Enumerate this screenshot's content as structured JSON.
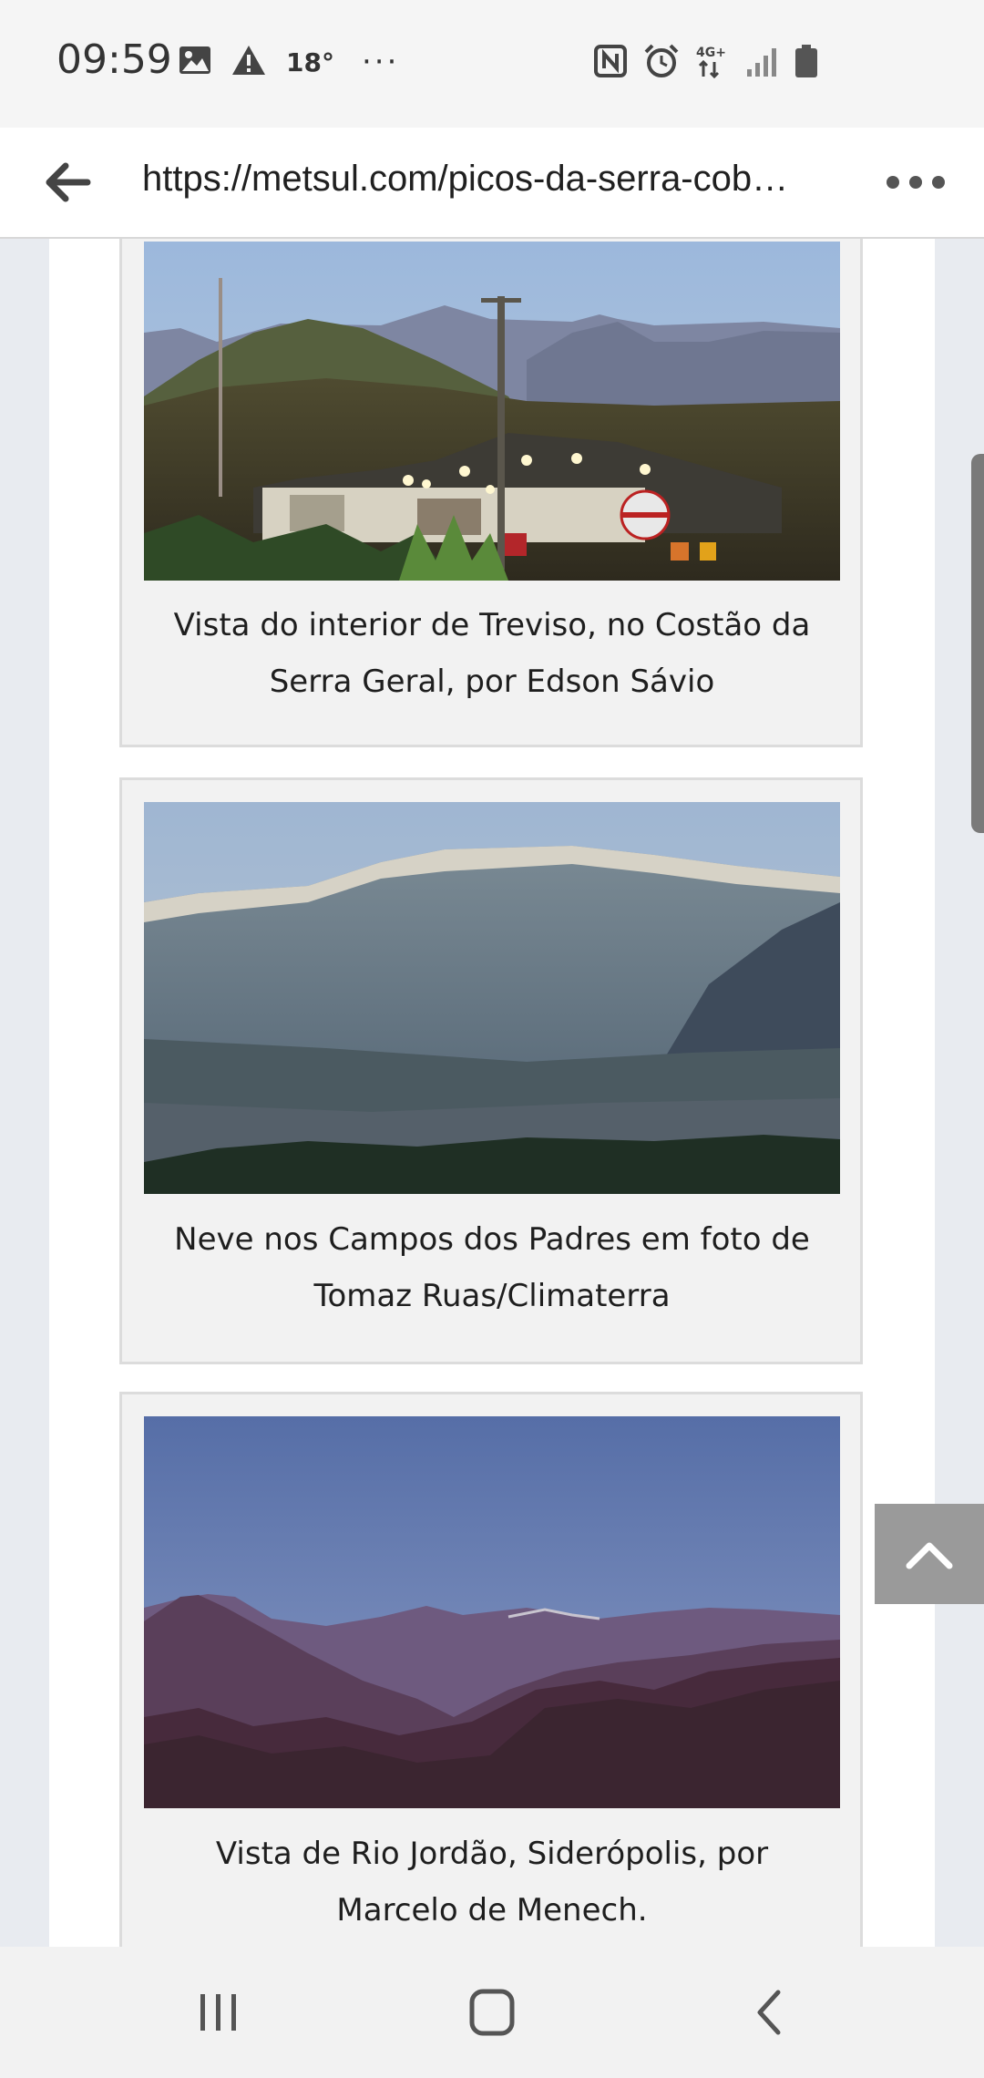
{
  "status_bar": {
    "time": "09:59",
    "temperature": "18°",
    "overflow": "···",
    "network": "4G+",
    "icons_left": [
      "image-icon",
      "warning-icon"
    ],
    "icons_right": [
      "nfc-icon",
      "alarm-icon",
      "network-4g-icon",
      "signal-icon",
      "battery-icon"
    ]
  },
  "browser": {
    "url": "https://metsul.com/picos-da-serra-cob…"
  },
  "figures": [
    {
      "caption": "Vista do interior de Treviso, no Costão da Serra Geral, por Edson Sávio",
      "line1": "Vista do interior de Treviso, no Costão da",
      "line2": "Serra Geral, por Edson Sávio"
    },
    {
      "caption": "Neve nos Campos dos Padres em foto de Tomaz Ruas/Climaterra",
      "line1": "Neve nos Campos dos Padres em foto de",
      "line2": "Tomaz Ruas/Climaterra"
    },
    {
      "caption": "Vista de Rio Jordão, Siderópolis, por Marcelo de Menech.",
      "line1": "Vista de Rio Jordão, Siderópolis, por",
      "line2": "Marcelo de Menech."
    }
  ],
  "colors": {
    "page_bg": "#e8ebf0",
    "card_bg": "#f2f2f2",
    "card_border": "#dcdcdc",
    "scroll_top_button": "#9a9a9a"
  }
}
